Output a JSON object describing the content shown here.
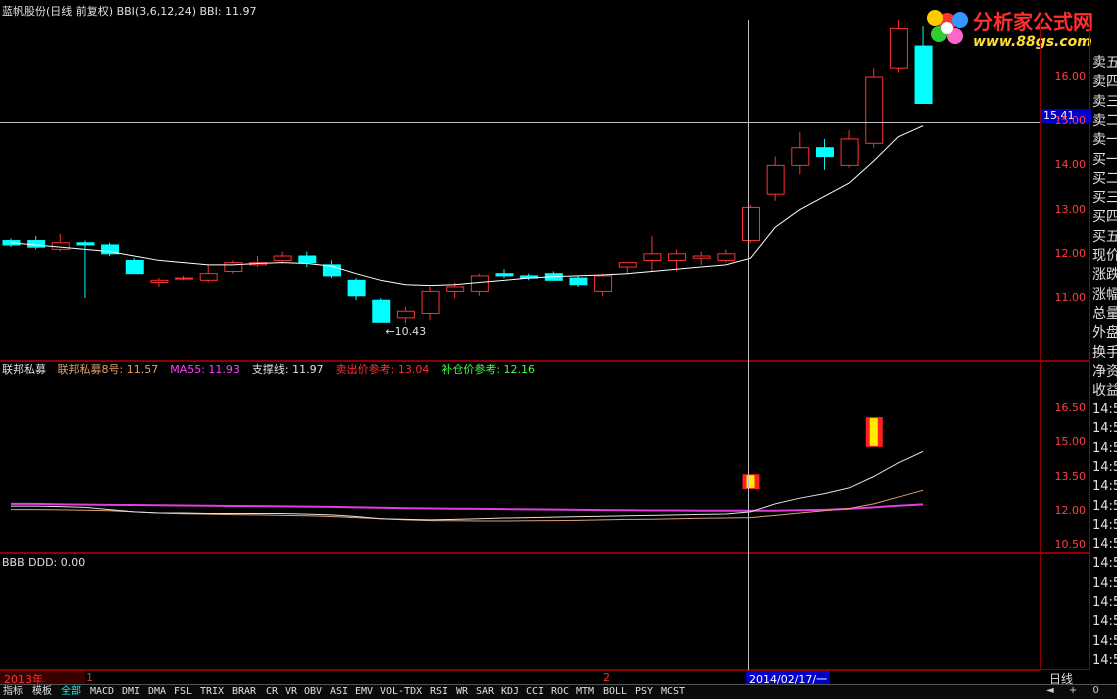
{
  "header": {
    "title": "蓝帆股份(日线 前复权)",
    "indicator": "BBI(3,6,12,24) BBI: 11.97"
  },
  "logo": {
    "name": "分析家公式网",
    "url": "www.88gs.com"
  },
  "price_panel": {
    "y_labels": [
      "16.00",
      "15.00",
      "14.00",
      "13.00",
      "12.00",
      "11.00"
    ],
    "crosshair_value": "15.41",
    "low_marker": "10.43"
  },
  "indicator_panel": {
    "name": "联邦私募",
    "items": [
      {
        "label": "联邦私募8号:",
        "value": "11.57",
        "color": "#e0a070"
      },
      {
        "label": "MA55:",
        "value": "11.93",
        "color": "#ff40ff"
      },
      {
        "label": "支撑线:",
        "value": "11.97",
        "color": "#e0e0e0"
      },
      {
        "label": "卖出价参考:",
        "value": "13.04",
        "color": "#ff3030"
      },
      {
        "label": "补仓价参考:",
        "value": "12.16",
        "color": "#40ff40"
      }
    ],
    "y_labels": [
      "16.50",
      "15.00",
      "13.50",
      "12.00",
      "10.50"
    ]
  },
  "bottom_panel": {
    "title": "BBB DDD: 0.00"
  },
  "right_column": {
    "labels": [
      "卖五",
      "卖四",
      "卖三",
      "卖二",
      "卖一",
      "买一",
      "买二",
      "买三",
      "买四",
      "买五",
      "现价",
      "涨跌",
      "涨幅",
      "总量",
      "外盘",
      "换手",
      "净资",
      "收益"
    ],
    "repeated_values": [
      "14:5",
      "14:5",
      "14:5",
      "14:5",
      "14:5",
      "14:5",
      "14:5",
      "14:5",
      "14:5",
      "14:5",
      "14:5",
      "14:5",
      "14:5",
      "14:5",
      "14:5"
    ]
  },
  "timebar": {
    "year": "2013年",
    "m1": "1",
    "m2": "2",
    "date": "2014/02/17/一",
    "period": "日线"
  },
  "tabs": [
    "指标",
    "模板",
    "全部",
    "MACD",
    "DMI",
    "DMA",
    "FSL",
    "TRIX",
    "BRAR",
    "CR",
    "VR",
    "OBV",
    "ASI",
    "EMV",
    "VOL-TDX",
    "RSI",
    "WR",
    "SAR",
    "KDJ",
    "CCI",
    "ROC",
    "MTM",
    "BOLL",
    "PSY",
    "MCST"
  ],
  "nav": {
    "prev": "◄",
    "plus": "+",
    "zero": "0"
  },
  "colors": {
    "up": "#ff3232",
    "down": "#00ffff",
    "border": "#8b0000",
    "bbi": "#ffffff"
  },
  "chart_data": {
    "type": "candlestick",
    "series_count": 38,
    "candles": [
      {
        "o": 12.3,
        "h": 12.35,
        "l": 12.15,
        "c": 12.2
      },
      {
        "o": 12.3,
        "h": 12.4,
        "l": 12.1,
        "c": 12.15
      },
      {
        "o": 12.1,
        "h": 12.45,
        "l": 12.05,
        "c": 12.25
      },
      {
        "o": 12.25,
        "h": 12.3,
        "l": 11.0,
        "c": 12.2
      },
      {
        "o": 12.2,
        "h": 12.25,
        "l": 11.95,
        "c": 12.0
      },
      {
        "o": 11.85,
        "h": 11.9,
        "l": 11.55,
        "c": 11.55
      },
      {
        "o": 11.35,
        "h": 11.45,
        "l": 11.25,
        "c": 11.4
      },
      {
        "o": 11.45,
        "h": 11.5,
        "l": 11.4,
        "c": 11.45
      },
      {
        "o": 11.4,
        "h": 11.75,
        "l": 11.35,
        "c": 11.55
      },
      {
        "o": 11.6,
        "h": 11.85,
        "l": 11.55,
        "c": 11.8
      },
      {
        "o": 11.75,
        "h": 11.95,
        "l": 11.7,
        "c": 11.8
      },
      {
        "o": 11.85,
        "h": 12.05,
        "l": 11.8,
        "c": 11.95
      },
      {
        "o": 11.95,
        "h": 12.05,
        "l": 11.7,
        "c": 11.8
      },
      {
        "o": 11.75,
        "h": 11.85,
        "l": 11.45,
        "c": 11.5
      },
      {
        "o": 11.4,
        "h": 11.45,
        "l": 10.95,
        "c": 11.05
      },
      {
        "o": 10.95,
        "h": 11.0,
        "l": 10.45,
        "c": 10.45
      },
      {
        "o": 10.55,
        "h": 10.8,
        "l": 10.43,
        "c": 10.7
      },
      {
        "o": 10.65,
        "h": 11.25,
        "l": 10.5,
        "c": 11.15
      },
      {
        "o": 11.15,
        "h": 11.35,
        "l": 11.0,
        "c": 11.25
      },
      {
        "o": 11.15,
        "h": 11.55,
        "l": 11.05,
        "c": 11.5
      },
      {
        "o": 11.55,
        "h": 11.65,
        "l": 11.45,
        "c": 11.5
      },
      {
        "o": 11.5,
        "h": 11.55,
        "l": 11.4,
        "c": 11.45
      },
      {
        "o": 11.55,
        "h": 11.6,
        "l": 11.4,
        "c": 11.4
      },
      {
        "o": 11.45,
        "h": 11.5,
        "l": 11.25,
        "c": 11.3
      },
      {
        "o": 11.15,
        "h": 11.55,
        "l": 11.05,
        "c": 11.5
      },
      {
        "o": 11.7,
        "h": 11.8,
        "l": 11.55,
        "c": 11.8
      },
      {
        "o": 11.85,
        "h": 12.4,
        "l": 11.6,
        "c": 12.0
      },
      {
        "o": 11.85,
        "h": 12.1,
        "l": 11.6,
        "c": 12.0
      },
      {
        "o": 11.9,
        "h": 12.05,
        "l": 11.75,
        "c": 11.95
      },
      {
        "o": 11.85,
        "h": 12.1,
        "l": 11.8,
        "c": 12.0
      },
      {
        "o": 12.3,
        "h": 13.1,
        "l": 12.25,
        "c": 13.05
      },
      {
        "o": 13.35,
        "h": 14.2,
        "l": 13.2,
        "c": 14.0
      },
      {
        "o": 14.0,
        "h": 14.75,
        "l": 13.8,
        "c": 14.4
      },
      {
        "o": 14.4,
        "h": 14.6,
        "l": 13.9,
        "c": 14.2
      },
      {
        "o": 14.0,
        "h": 14.8,
        "l": 13.95,
        "c": 14.6
      },
      {
        "o": 14.5,
        "h": 16.2,
        "l": 14.4,
        "c": 16.0
      },
      {
        "o": 16.2,
        "h": 17.45,
        "l": 16.1,
        "c": 17.1
      },
      {
        "o": 16.7,
        "h": 17.15,
        "l": 15.4,
        "c": 15.4
      }
    ],
    "bbi": [
      12.25,
      12.2,
      12.15,
      12.1,
      12.05,
      11.95,
      11.85,
      11.8,
      11.75,
      11.75,
      11.78,
      11.8,
      11.78,
      11.72,
      11.55,
      11.4,
      11.3,
      11.28,
      11.3,
      11.35,
      11.4,
      11.45,
      11.48,
      11.5,
      11.52,
      11.55,
      11.6,
      11.65,
      11.7,
      11.75,
      11.9,
      12.6,
      13.0,
      13.3,
      13.6,
      14.1,
      14.65,
      14.9
    ],
    "ind_white": [
      12.2,
      12.2,
      12.18,
      12.15,
      12.05,
      11.95,
      11.9,
      11.9,
      11.88,
      11.88,
      11.88,
      11.88,
      11.85,
      11.82,
      11.75,
      11.65,
      11.62,
      11.6,
      11.62,
      11.65,
      11.68,
      11.7,
      11.72,
      11.74,
      11.76,
      11.78,
      11.8,
      11.82,
      11.84,
      11.86,
      11.95,
      12.3,
      12.55,
      12.75,
      13.0,
      13.5,
      14.1,
      14.6
    ],
    "ind_magenta": [
      12.3,
      12.3,
      12.28,
      12.27,
      12.26,
      12.25,
      12.24,
      12.23,
      12.22,
      12.21,
      12.2,
      12.19,
      12.18,
      12.17,
      12.15,
      12.13,
      12.11,
      12.1,
      12.09,
      12.08,
      12.07,
      12.06,
      12.05,
      12.04,
      12.03,
      12.02,
      12.01,
      12.01,
      12.0,
      12.0,
      12.0,
      12.0,
      12.02,
      12.04,
      12.08,
      12.15,
      12.22,
      12.28
    ],
    "ind_tan": [
      12.05,
      12.05,
      12.04,
      12.02,
      12.0,
      11.95,
      11.9,
      11.87,
      11.85,
      11.83,
      11.82,
      11.8,
      11.78,
      11.75,
      11.7,
      11.65,
      11.6,
      11.57,
      11.56,
      11.55,
      11.55,
      11.56,
      11.57,
      11.58,
      11.6,
      11.62,
      11.63,
      11.65,
      11.67,
      11.68,
      11.7,
      11.8,
      11.9,
      12.0,
      12.1,
      12.3,
      12.6,
      12.9
    ],
    "ind_bars": [
      {
        "index": 30,
        "lo": 12.95,
        "hi": 13.6
      },
      {
        "index": 35,
        "lo": 14.8,
        "hi": 16.1
      }
    ]
  }
}
